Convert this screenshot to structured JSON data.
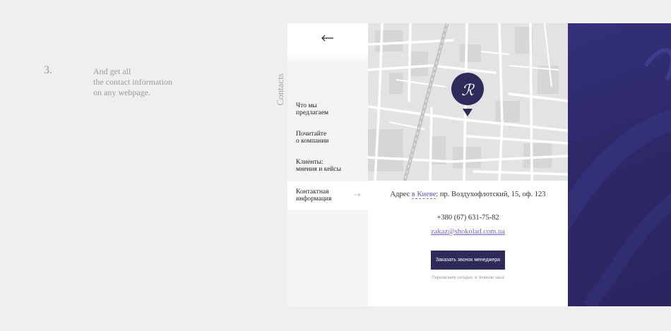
{
  "step": {
    "number": "3.",
    "lines": [
      "And get all",
      "the contact information",
      "on any webpage."
    ]
  },
  "section_label": "Contacts",
  "sidebar": {
    "back_icon": "arrow-left-icon",
    "items": [
      {
        "lines": [
          "Что мы",
          "предлагаем"
        ],
        "active": false
      },
      {
        "lines": [
          "Почитайте",
          "о компании"
        ],
        "active": false
      },
      {
        "lines": [
          "Клиенты:",
          "мнения и кейсы"
        ],
        "active": false
      },
      {
        "lines": [
          "Контактная",
          "информация"
        ],
        "active": true
      }
    ]
  },
  "map": {
    "marker_icon": "map-pin-logo-icon",
    "marker_color": "#2e2a5a"
  },
  "contact": {
    "address_prefix": "Адрес",
    "city_link": "в Киеве",
    "address_rest": ": пр. Воздухофлотский, 15, оф. 123",
    "phone": "+380 (67) 631-75-82",
    "email": "zakaz@shokolad.com.ua",
    "cta_label": "Заказать звонок менеджера",
    "note": "Перезвоним сегодня, в течение часа"
  },
  "colors": {
    "brand": "#2e2a5a",
    "link": "#6b66c8",
    "panel": "#2d2968"
  }
}
